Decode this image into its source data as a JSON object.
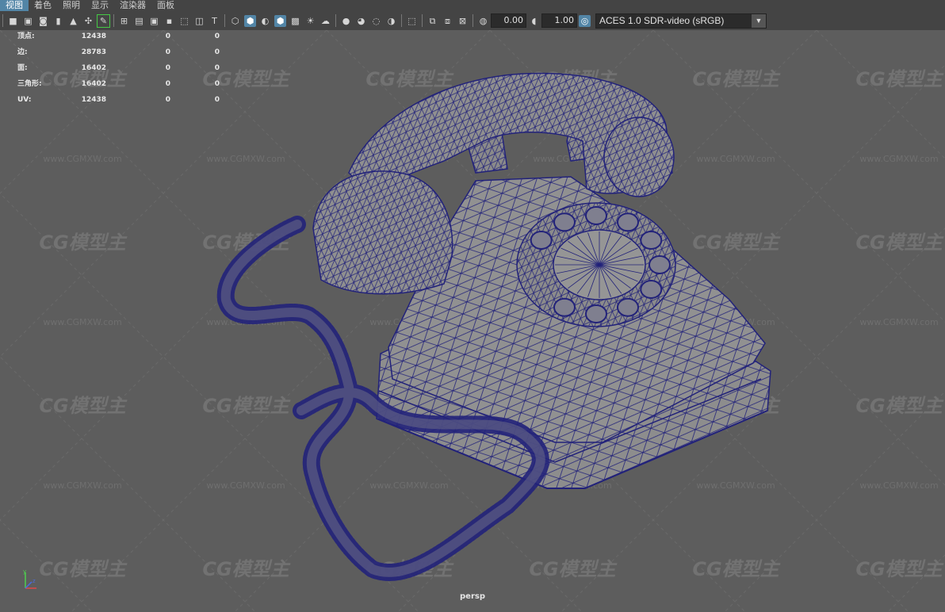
{
  "menubar": {
    "items": [
      {
        "label": "视图",
        "active": true
      },
      {
        "label": "着色"
      },
      {
        "label": "照明"
      },
      {
        "label": "显示"
      },
      {
        "label": "渲染器"
      },
      {
        "label": "面板"
      }
    ]
  },
  "toolbar": {
    "exposure": "0.00",
    "gamma": "1.00",
    "color_space": "ACES 1.0 SDR-video (sRGB)"
  },
  "hud": {
    "stats": [
      {
        "label": "顶点:",
        "values": [
          "12438",
          "0",
          "0"
        ]
      },
      {
        "label": "边:",
        "values": [
          "28783",
          "0",
          "0"
        ]
      },
      {
        "label": "面:",
        "values": [
          "16402",
          "0",
          "0"
        ]
      },
      {
        "label": "三角形:",
        "values": [
          "16402",
          "0",
          "0"
        ]
      },
      {
        "label": "UV:",
        "values": [
          "12438",
          "0",
          "0"
        ]
      }
    ],
    "camera": "persp"
  },
  "watermark": {
    "logo": "CG模型主",
    "url": "www.CGMXW.com"
  },
  "colors": {
    "viewport_bg": "#5d5d5d",
    "wireframe": "#22227a",
    "menu_active": "#5285a6"
  }
}
